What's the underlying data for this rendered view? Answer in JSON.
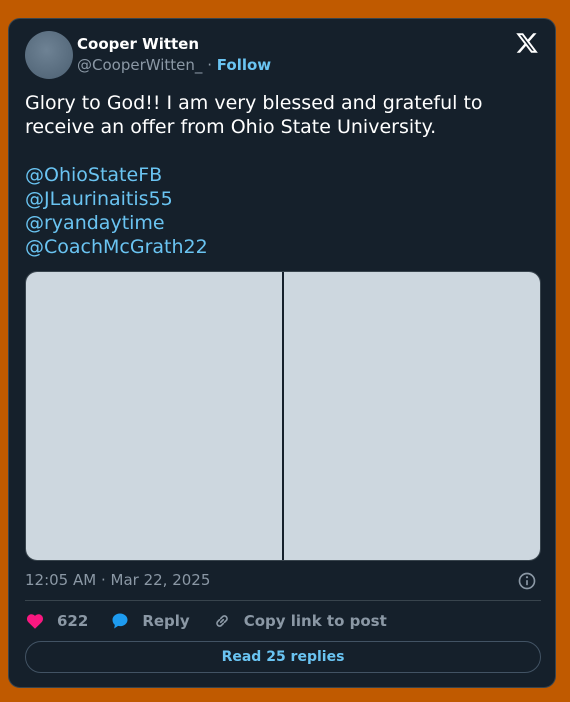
{
  "author": {
    "name": "Cooper Witten",
    "handle": "@CooperWitten_",
    "separator": "·",
    "follow_label": "Follow"
  },
  "tweet": {
    "text": "Glory to God!! I am very blessed and grateful to receive an offer from Ohio State University.",
    "mentions": [
      "@OhioStateFB",
      "@JLaurinaitis55",
      "@ryandaytime",
      "@CoachMcGrath22"
    ]
  },
  "timestamp": "12:05 AM · Mar 22, 2025",
  "actions": {
    "likes_count": "622",
    "reply_label": "Reply",
    "copy_link_label": "Copy link to post"
  },
  "read_replies_label": "Read 25 replies",
  "icons": {
    "logo": "x-logo-icon",
    "info": "info-icon",
    "like": "heart-icon",
    "reply": "speech-bubble-icon",
    "copy": "link-icon"
  },
  "colors": {
    "card_bg": "#15202b",
    "page_bg": "#c05a00",
    "link": "#6ac4f2",
    "like": "#f91880",
    "reply": "#1d9bf0"
  }
}
